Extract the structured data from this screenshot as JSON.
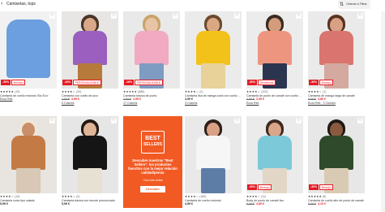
{
  "header": {
    "back_icon": "chevron-left-icon",
    "title": "Camisetas, tops",
    "filter_label": "Ordenar & Filtrar",
    "filter_icon": "sliders-icon"
  },
  "row1": [
    {
      "discount": "-30%",
      "tag": "Moda(s)",
      "stars": "★★★★★",
      "rating": "(19)",
      "name": "Camiseta de cuello redondo 'Bio Eco'",
      "old_price": "",
      "price": "",
      "colors": "Ecos Rek",
      "fav": "♡"
    },
    {
      "discount": "-16%",
      "tag": "PERSONALIZABLE",
      "stars": "★★★★☆",
      "rating": "(34)",
      "name": "Camiseta con cuello de pico",
      "old_price": "4,99 €",
      "price": "3,99 €",
      "colors": "5 Colores",
      "fav": "♡"
    },
    {
      "discount": "-16%",
      "tag": "PERSONALIZABLE",
      "stars": "★★★★★",
      "rating": "(886)",
      "name": "Camiseta básica de punto",
      "old_price": "4,99 €",
      "price": "3,99 €",
      "colors": "17 Colores",
      "fav": "♡"
    },
    {
      "discount": "",
      "tag": "",
      "stars": "★★★★☆",
      "rating": "(2)",
      "name": "Camiseta lisa de manga corta con cuello redondo",
      "old_price": "",
      "price": "4,99 €",
      "colors": "3 Colores",
      "fav": "♡"
    },
    {
      "discount": "-30%",
      "tag": "Tendencias",
      "stars": "★★★★☆",
      "rating": "(103)",
      "name": "Camiseta de punto de canalé con cuello barco",
      "old_price": "4,99 €",
      "price": "3,49 €",
      "colors": "Ecos Rek",
      "fav": "♡"
    },
    {
      "discount": "-30%",
      "tag": "Moda(s)",
      "stars": "★★★★☆",
      "rating": "(1)",
      "name": "Camiseta de manga larga de canalé",
      "old_price": "6,99 €",
      "price": "4,89 €",
      "colors": "Ecos Rek · 2 Colores",
      "fav": "♡"
    }
  ],
  "row2": [
    {
      "discount": "",
      "tag": "",
      "stars": "★★★★☆",
      "rating": "(19)",
      "name": "Camiseta corta tipo calada",
      "old_price": "",
      "price": "5,99 €",
      "colors": "",
      "fav": "♡"
    },
    {
      "discount": "",
      "tag": "",
      "stars": "★★★★☆",
      "rating": "(2)",
      "name": "Camiseta básica con escote pronunciado",
      "old_price": "",
      "price": "5,99 €",
      "colors": "",
      "fav": "♡"
    },
    {
      "discount": "",
      "tag": "",
      "stars": "★★★★☆",
      "rating": "(183)",
      "name": "Camiseta de cuello redondo",
      "old_price": "",
      "price": "4,99 €",
      "colors": "",
      "fav": "♡"
    },
    {
      "discount": "-30%",
      "tag": "Moda(s)",
      "stars": "★★★★☆",
      "rating": "(11)",
      "name": "Body de punto de canalé liso",
      "old_price": "6,99 €",
      "price": "4,89 €",
      "colors": "",
      "fav": "♡"
    },
    {
      "discount": "-30%",
      "tag": "Moda(s)",
      "stars": "★★★★★",
      "rating": "(8)",
      "name": "Camiseta de cuello alto de punto de canalé",
      "old_price": "5,99 €",
      "price": "4,19 €",
      "colors": "",
      "fav": "♡"
    }
  ],
  "promo": {
    "logo_line1": "BEST",
    "logo_line2": "SELLERS",
    "text": "Descubre nuestros \"Best Sellers\": los productos favoritos con la mejor relación calidad/precio",
    "sub": "*Con más ventas",
    "button": "Descubrir"
  },
  "colors": {
    "accent": "#e41c24",
    "promo_bg": "#f25a24"
  }
}
